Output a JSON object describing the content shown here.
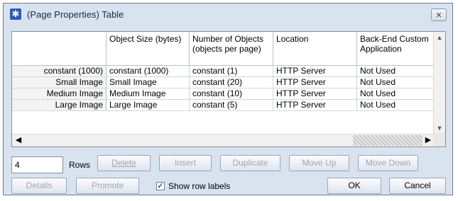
{
  "window": {
    "title": "(Page Properties) Table",
    "close_glyph": "✕"
  },
  "table": {
    "columns": [
      "",
      "Object Size (bytes)",
      "Number of Objects (objects per page)",
      "Location",
      "Back-End Custom Application"
    ],
    "rows": [
      {
        "label": "constant (1000)",
        "cells": [
          "constant (1000)",
          "constant (1)",
          "HTTP Server",
          "Not Used"
        ]
      },
      {
        "label": "Small Image",
        "cells": [
          "Small Image",
          "constant (20)",
          "HTTP Server",
          "Not Used"
        ]
      },
      {
        "label": "Medium Image",
        "cells": [
          "Medium Image",
          "constant (10)",
          "HTTP Server",
          "Not Used"
        ]
      },
      {
        "label": "Large Image",
        "cells": [
          "Large Image",
          "constant (5)",
          "HTTP Server",
          "Not Used"
        ]
      }
    ]
  },
  "controls": {
    "rows_value": "4",
    "rows_label": "Rows",
    "delete_label": "Delete",
    "insert_label": "Insert",
    "duplicate_label": "Duplicate",
    "move_up_label": "Move Up",
    "move_down_label": "Move Down",
    "details_label": "Details",
    "promote_label": "Promote",
    "show_row_labels": "Show row labels",
    "show_row_labels_checked": true,
    "ok_label": "OK",
    "cancel_label": "Cancel"
  },
  "colors": {
    "window_bg": "#d9e3f0",
    "grid_border": "#7f8fa8",
    "disabled_text": "#a0a6b0"
  }
}
